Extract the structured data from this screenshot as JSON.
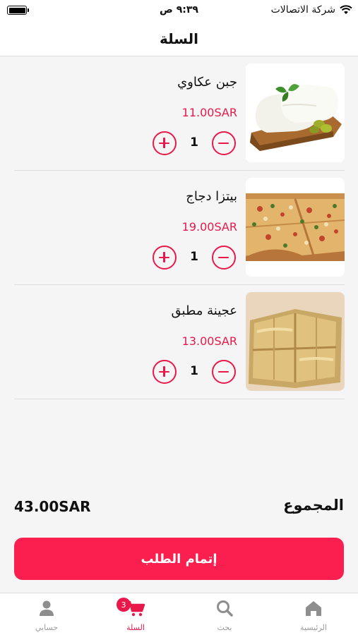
{
  "status_bar": {
    "time": "٩:٣٩ ص",
    "carrier": "شركة الاتصالات",
    "icons": [
      "battery-icon",
      "wifi-icon"
    ]
  },
  "header": {
    "title": "السلة"
  },
  "cart": {
    "items": [
      {
        "name": "جبن عكاوي",
        "price": "11.00SAR",
        "quantity": "1",
        "image": "akkawi-cheese-photo"
      },
      {
        "name": "بيتزا دجاج",
        "price": "19.00SAR",
        "quantity": "1",
        "image": "chicken-pizza-photo"
      },
      {
        "name": "عجينة مطبق",
        "price": "13.00SAR",
        "quantity": "1",
        "image": "mutabbaq-pastry-photo"
      }
    ]
  },
  "summary": {
    "total_label": "المجموع",
    "total_value": "43.00SAR"
  },
  "checkout": {
    "label": "إتمام الطلب"
  },
  "tab_bar": {
    "tabs": [
      {
        "label": "الرئيسية",
        "icon": "home-icon"
      },
      {
        "label": "بحث",
        "icon": "search-icon"
      },
      {
        "label": "السلة",
        "icon": "cart-icon",
        "badge": "3",
        "active": true
      },
      {
        "label": "حسابي",
        "icon": "user-icon"
      }
    ]
  },
  "colors": {
    "accent": "#e8194a",
    "button": "#fb1f4f",
    "background": "#f5f5f5"
  }
}
